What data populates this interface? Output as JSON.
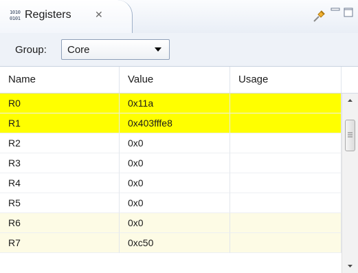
{
  "view": {
    "title": "Registers",
    "icon": "registers-icon",
    "icon_text": [
      "1010",
      "0101"
    ],
    "close_glyph": "✕"
  },
  "toolbar": {
    "group_label": "Group:",
    "group_value": "Core"
  },
  "table": {
    "columns": [
      "Name",
      "Value",
      "Usage"
    ],
    "rows": [
      {
        "name": "R0",
        "value": "0x11a",
        "usage": "",
        "state": "changed"
      },
      {
        "name": "R1",
        "value": "0x403fffe8",
        "usage": "",
        "state": "changed"
      },
      {
        "name": "R2",
        "value": "0x0",
        "usage": "",
        "state": "plain"
      },
      {
        "name": "R3",
        "value": "0x0",
        "usage": "",
        "state": "plain"
      },
      {
        "name": "R4",
        "value": "0x0",
        "usage": "",
        "state": "plain"
      },
      {
        "name": "R5",
        "value": "0x0",
        "usage": "",
        "state": "plain"
      },
      {
        "name": "R6",
        "value": "0x0",
        "usage": "",
        "state": "alt"
      },
      {
        "name": "R7",
        "value": "0xc50",
        "usage": "",
        "state": "alt"
      }
    ]
  },
  "scrollbar": {
    "position": 0.1
  },
  "colors": {
    "changed_row": "#ffff00",
    "alt_row": "#fdfbe5",
    "tab_border": "#9fb0c8"
  }
}
